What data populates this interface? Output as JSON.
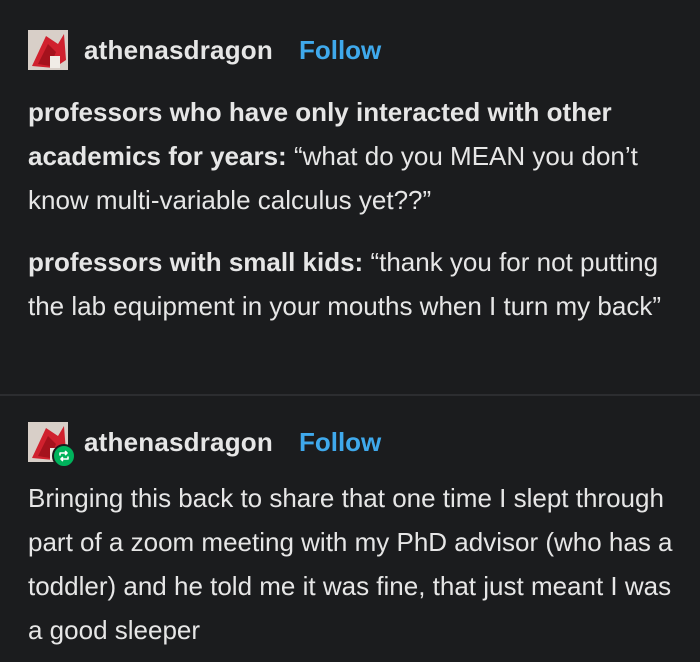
{
  "posts": [
    {
      "username": "athenasdragon",
      "follow_label": "Follow",
      "avatar_icon": "avatar-icon",
      "paragraphs": [
        {
          "bold": "professors who have only interacted with other academics for years:",
          "text": " “what do you MEAN you don’t know multi-variable calculus yet??”"
        },
        {
          "bold": "professors with small kids:",
          "text": " “thank you for not putting the lab equipment in your mouths when I turn my back”"
        }
      ]
    },
    {
      "username": "athenasdragon",
      "follow_label": "Follow",
      "avatar_icon": "avatar-icon",
      "badge_icon": "reblog-icon",
      "body": "Bringing this back to share that one time I slept through part of a zoom meeting with my PhD advisor (who has a toddler) and he told me it was fine, that just meant I was a good sleeper"
    }
  ],
  "colors": {
    "background": "#1b1c1e",
    "text": "#e6e6e6",
    "follow": "#3fa9ec",
    "reblog_badge": "#00b35c"
  }
}
